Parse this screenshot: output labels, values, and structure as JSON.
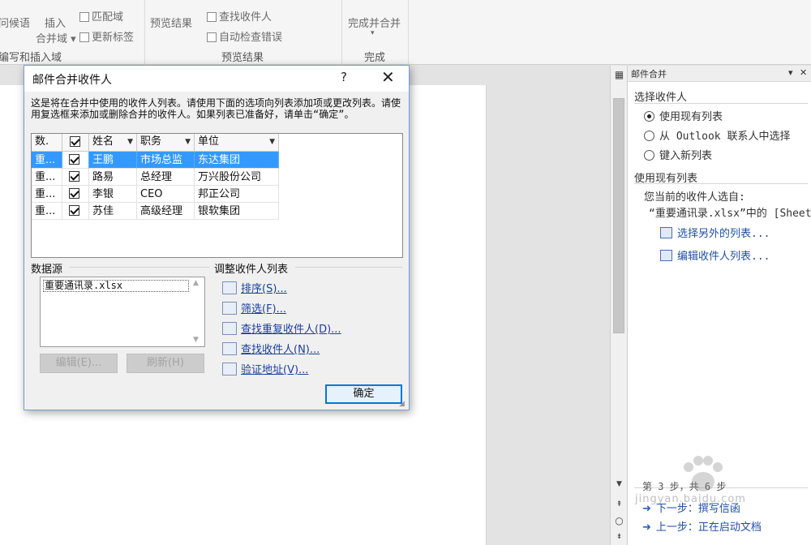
{
  "ribbon": {
    "greeting_label": "问候语",
    "insert_label": "插入",
    "merge_field_label": "合并域",
    "match_fields_label": "匹配域",
    "update_labels_label": "更新标签",
    "group1_label": "编写和插入域",
    "preview_results_btn": "预览结果",
    "find_recipient_label": "查找收件人",
    "auto_check_label": "自动检查错误",
    "group2_label": "预览结果",
    "finish_merge_label": "完成并合并",
    "group3_label": "完成"
  },
  "dialog": {
    "title": "邮件合并收件人",
    "help": "?",
    "close": "✕",
    "description": "这是将在合并中使用的收件人列表。请使用下面的选项向列表添加项或更改列表。请使用复选框来添加或删除合并的收件人。如果列表已准备好，请单击“确定”。",
    "columns": [
      "数.",
      "",
      "姓名",
      "职务",
      "单位"
    ],
    "rows": [
      {
        "source": "重...",
        "checked": true,
        "name": "王鹏",
        "title": "市场总监",
        "company": "东达集团",
        "selected": true
      },
      {
        "source": "重...",
        "checked": true,
        "name": "路易",
        "title": "总经理",
        "company": "万兴股份公司",
        "selected": false
      },
      {
        "source": "重...",
        "checked": true,
        "name": "李银",
        "title": "CEO",
        "company": "邦正公司",
        "selected": false
      },
      {
        "source": "重...",
        "checked": true,
        "name": "苏佳",
        "title": "高级经理",
        "company": "银软集团",
        "selected": false
      }
    ],
    "datasource_label": "数据源",
    "datasource_item": "重要通讯录.xlsx",
    "edit_btn": "编辑(E)...",
    "refresh_btn": "刷新(H)",
    "adjust_label": "调整收件人列表",
    "links": [
      "排序(S)...",
      "筛选(F)...",
      "查找重复收件人(D)...",
      "查找收件人(N)...",
      "验证地址(V)..."
    ],
    "ok_btn": "确定"
  },
  "taskpane": {
    "title": "邮件合并",
    "section1": "选择收件人",
    "options": [
      {
        "label": "使用现有列表",
        "selected": true
      },
      {
        "label": "从 Outlook 联系人中选择",
        "selected": false
      },
      {
        "label": "键入新列表",
        "selected": false
      }
    ],
    "section2": "使用现有列表",
    "current_from": "您当前的收件人选自:",
    "current_file": "“重要通讯录.xlsx”中的 [Sheet",
    "link_select_other": "选择另外的列表...",
    "link_edit_list": "编辑收件人列表...",
    "step_text": "第 3 步，共 6 步",
    "next_step": "下一步：撰写信函",
    "prev_step": "上一步：正在启动文档"
  },
  "watermark": {
    "text": "jingyan.baidu.com"
  }
}
